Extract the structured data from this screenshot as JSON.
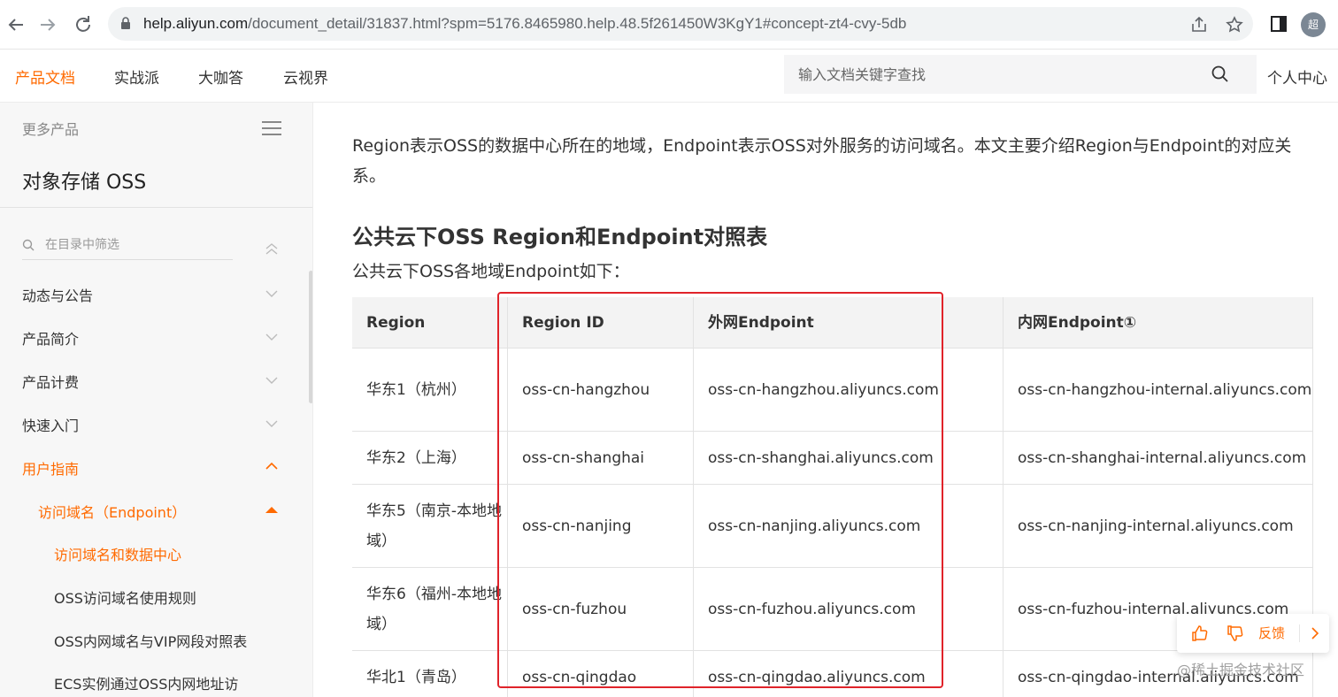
{
  "browser": {
    "url_host": "help.aliyun.com",
    "url_path": "/document_detail/31837.html?spm=5176.8465980.help.48.5f261450W3KgY1#concept-zt4-cvy-5db",
    "avatar_text": "超"
  },
  "header": {
    "nav": [
      "产品文档",
      "实战派",
      "大咖答",
      "云视界"
    ],
    "search_placeholder": "输入文档关键字查找",
    "personal_center": "个人中心"
  },
  "sidebar": {
    "more_products": "更多产品",
    "product_title": "对象存储 OSS",
    "filter_placeholder": "在目录中筛选",
    "items": [
      "动态与公告",
      "产品简介",
      "产品计费",
      "快速入门",
      "用户指南",
      "访问域名（Endpoint）",
      "访问域名和数据中心",
      "OSS访问域名使用规则",
      "OSS内网域名与VIP网段对照表",
      "ECS实例通过OSS内网地址访"
    ]
  },
  "content": {
    "intro": "Region表示OSS的数据中心所在的地域，Endpoint表示OSS对外服务的访问域名。本文主要介绍Region与Endpoint的对应关系。",
    "section_title": "公共云下OSS Region和Endpoint对照表",
    "subtitle": "公共云下OSS各地域Endpoint如下：",
    "table": {
      "headers": [
        "Region",
        "Region ID",
        "外网Endpoint",
        "内网Endpoint①"
      ],
      "rows": [
        [
          "华东1（杭州）",
          "oss-cn-hangzhou",
          "oss-cn-hangzhou.aliyuncs.com",
          "oss-cn-hangzhou-internal.aliyuncs.com"
        ],
        [
          "华东2（上海）",
          "oss-cn-shanghai",
          "oss-cn-shanghai.aliyuncs.com",
          "oss-cn-shanghai-internal.aliyuncs.com"
        ],
        [
          "华东5（南京-本地地域）",
          "oss-cn-nanjing",
          "oss-cn-nanjing.aliyuncs.com",
          "oss-cn-nanjing-internal.aliyuncs.com"
        ],
        [
          "华东6（福州-本地地域）",
          "oss-cn-fuzhou",
          "oss-cn-fuzhou.aliyuncs.com",
          "oss-cn-fuzhou-internal.aliyuncs.com"
        ],
        [
          "华北1（青岛）",
          "oss-cn-qingdao",
          "oss-cn-qingdao.aliyuncs.com",
          "oss-cn-qingdao-internal.aliyuncs.com"
        ]
      ]
    }
  },
  "feedback": {
    "label": "反馈"
  },
  "watermark": "@稀土掘金技术社区",
  "colors": {
    "accent": "#ff6a00",
    "highlight_box": "#e0232a"
  }
}
